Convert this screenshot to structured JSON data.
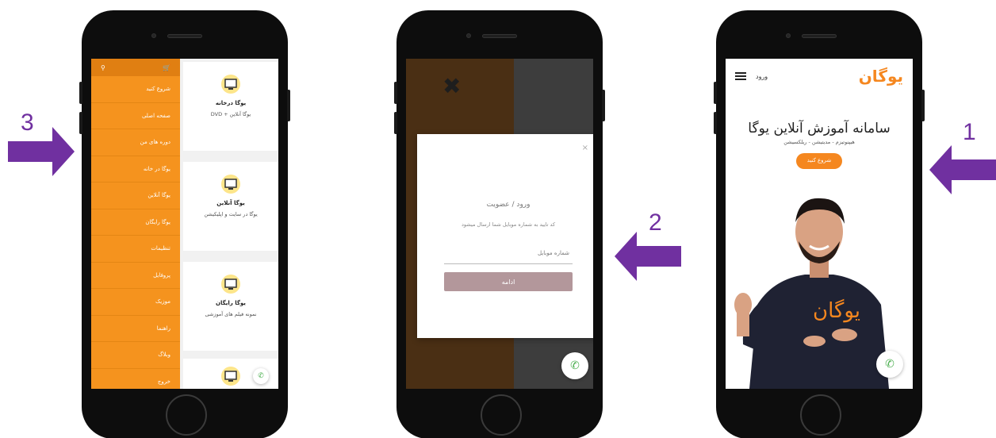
{
  "steps": {
    "one": "1",
    "two": "2",
    "three": "3"
  },
  "screen1": {
    "logo": "یوگان",
    "login_label": "ورود",
    "title": "سامانه آموزش آنلاین یوگا",
    "subtitle": "هیپنوتیزم - مدیتیشن - ریلکسیشن",
    "cta_label": "شروع کنید",
    "shirt_logo": "یوگان"
  },
  "screen2": {
    "close_glyph": "×",
    "modal_title": "ورود / عضویت",
    "modal_desc": "کد تایید به شماره موبایل شما ارسال میشود",
    "phone_placeholder": "شماره موبایل",
    "continue_label": "ادامه"
  },
  "screen3": {
    "menu_items": [
      "شروع کنید",
      "صفحه اصلی",
      "دوره های من",
      "یوگا در خانه",
      "یوگا آنلاین",
      "یوگا رایگان",
      "تنظیمات",
      "پروفایل",
      "موزیک",
      "راهنما",
      "وبلاگ",
      "خروج"
    ],
    "cards": [
      {
        "title": "یوگا درخانه",
        "desc": "یوگا آنلاین + DVD"
      },
      {
        "title": "یوگا آنلاین",
        "desc": "یوگا در سایت و اپلیکیشن"
      },
      {
        "title": "یوگا رایگان",
        "desc": "نمونه فیلم های آموزشی"
      }
    ]
  },
  "colors": {
    "brand": "#f5871f",
    "arrow": "#7030a0",
    "button_muted": "#b3979b"
  },
  "icons": [
    "search-icon",
    "cart-icon",
    "menu-icon",
    "phone-icon",
    "close-icon"
  ]
}
